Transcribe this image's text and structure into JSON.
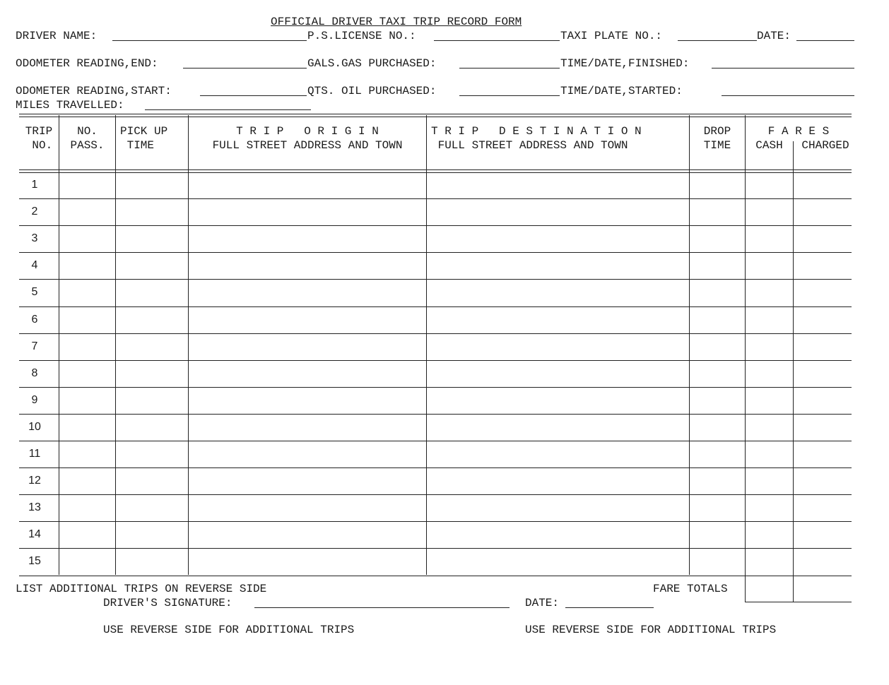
{
  "form": {
    "title": "OFFICIAL DRIVER TAXI TRIP RECORD FORM",
    "fields": {
      "driver_name": {
        "label": "DRIVER NAME:",
        "value": ""
      },
      "ps_license_no": {
        "label": "P.S.LICENSE NO.:",
        "value": ""
      },
      "taxi_plate_no": {
        "label": "TAXI PLATE NO.:",
        "value": ""
      },
      "date": {
        "label": "DATE:",
        "value": ""
      },
      "odometer_end": {
        "label": "ODOMETER READING,END:",
        "value": ""
      },
      "gals_gas": {
        "label": "GALS.GAS PURCHASED:",
        "value": ""
      },
      "time_date_finished": {
        "label": "TIME/DATE,FINISHED:",
        "value": ""
      },
      "odometer_start": {
        "label": "ODOMETER READING,START:",
        "value": ""
      },
      "qts_oil": {
        "label": "QTS. OIL PURCHASED:",
        "value": ""
      },
      "time_date_started": {
        "label": "TIME/DATE,STARTED:",
        "value": ""
      },
      "miles_travelled": {
        "label": "MILES TRAVELLED:",
        "value": ""
      }
    },
    "table": {
      "headers": {
        "trip_no": "TRIP\n NO.",
        "no_pass": "NO.\nPASS.",
        "pickup_time": "PICK UP\n TIME",
        "origin": "T R I P   O R I G I N\nFULL STREET ADDRESS AND TOWN",
        "destination": "T R I P   D E S T I N A T I O N\n FULL STREET ADDRESS AND TOWN",
        "drop_time": "DROP\nTIME",
        "fares": "F A R E S",
        "cash": "CASH",
        "charged": "CHARGED"
      },
      "rows": [
        {
          "trip_no": "1"
        },
        {
          "trip_no": "2"
        },
        {
          "trip_no": "3"
        },
        {
          "trip_no": "4"
        },
        {
          "trip_no": "5"
        },
        {
          "trip_no": "6"
        },
        {
          "trip_no": "7"
        },
        {
          "trip_no": "8"
        },
        {
          "trip_no": "9"
        },
        {
          "trip_no": "10"
        },
        {
          "trip_no": "11"
        },
        {
          "trip_no": "12"
        },
        {
          "trip_no": "13"
        },
        {
          "trip_no": "14"
        },
        {
          "trip_no": "15"
        }
      ]
    },
    "footer": {
      "list_additional": "LIST ADDITIONAL TRIPS ON REVERSE SIDE",
      "fare_totals": "FARE TOTALS",
      "signature": {
        "label": "DRIVER'S SIGNATURE:",
        "value": ""
      },
      "sign_date": {
        "label": "DATE:",
        "value": ""
      },
      "reverse_note_left": "USE REVERSE SIDE FOR ADDITIONAL TRIPS",
      "reverse_note_right": "USE REVERSE SIDE FOR ADDITIONAL TRIPS"
    }
  }
}
